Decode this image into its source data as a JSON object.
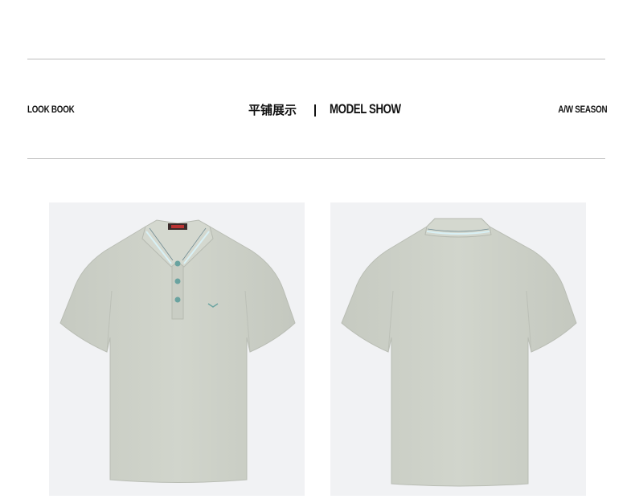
{
  "header": {
    "left_label": "LOOK BOOK",
    "center_cn": "平铺展示",
    "center_en": "MODEL SHOW",
    "right_label": "A/W SEASON"
  },
  "products": [
    {
      "view": "front",
      "shirt_color": "#cfd3ca",
      "collar_stripe": "#d8f0f5",
      "button_color": "#6aa3a0"
    },
    {
      "view": "back",
      "shirt_color": "#cfd3ca",
      "collar_stripe": "#d8f0f5"
    }
  ],
  "colors": {
    "background": "#ffffff",
    "panel": "#f1f2f4",
    "rule": "#bdbdbd"
  }
}
